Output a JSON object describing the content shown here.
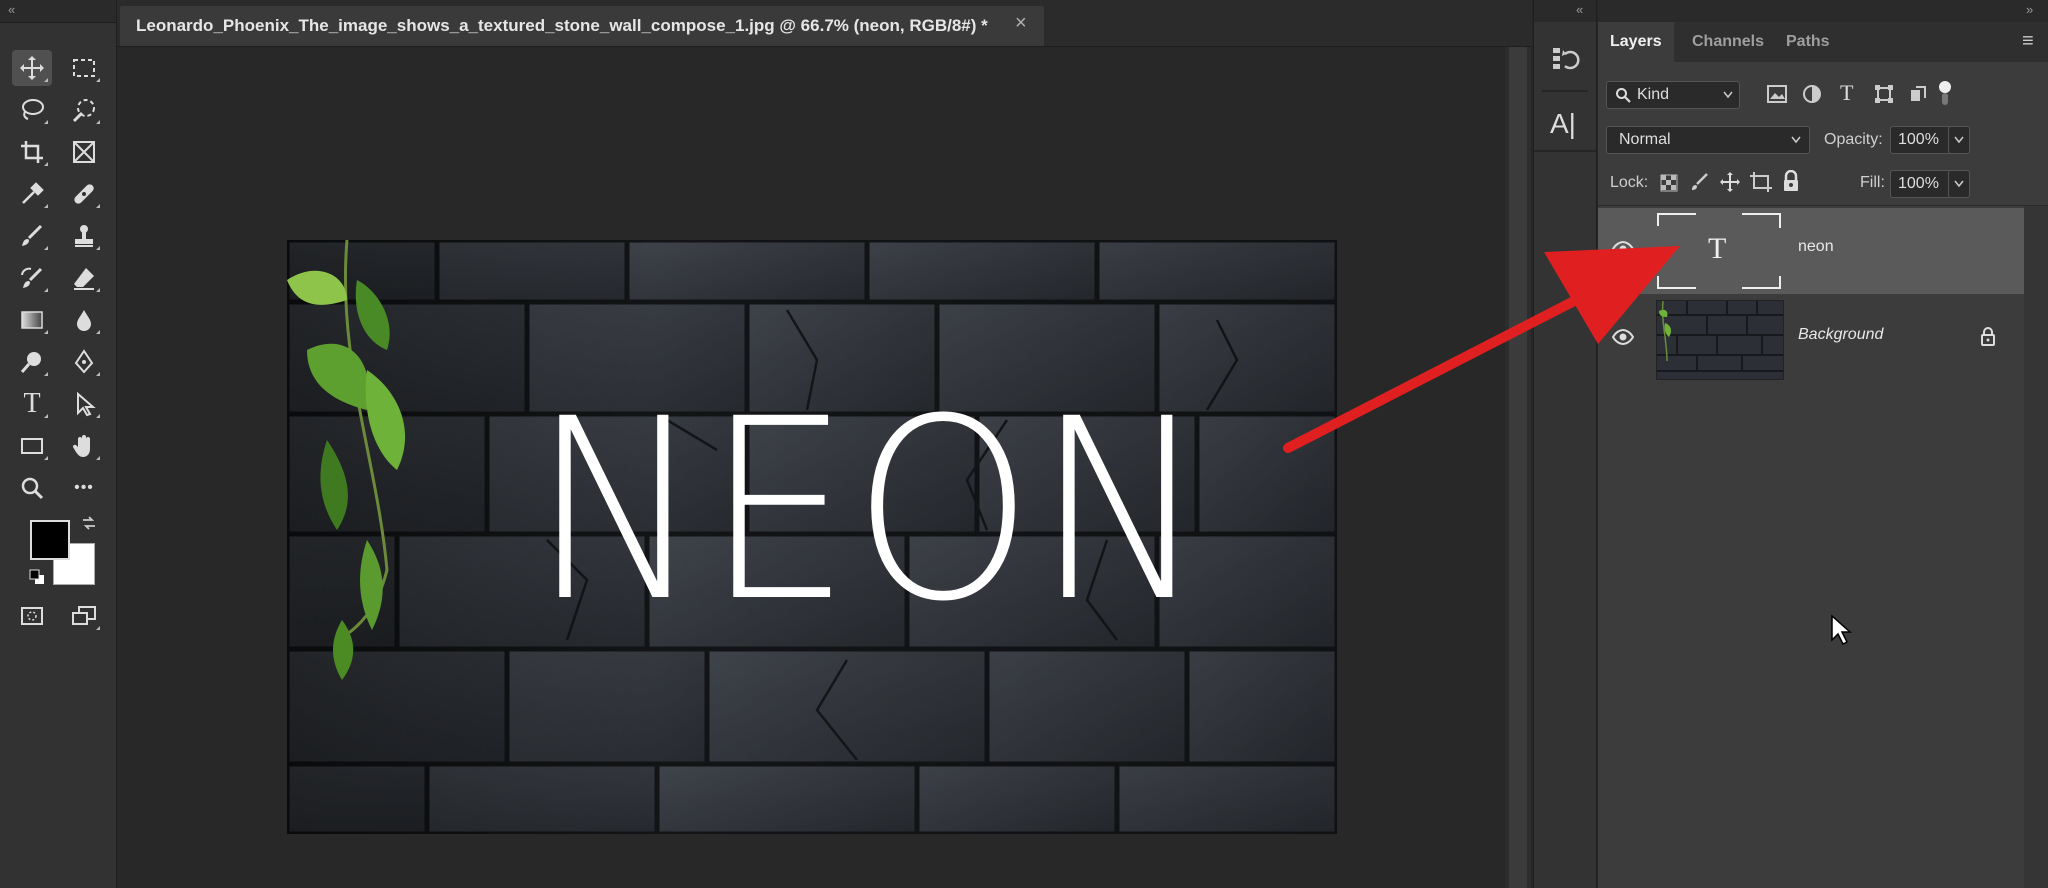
{
  "document": {
    "tab_title": "Leonardo_Phoenix_The_image_shows_a_textured_stone_wall_compose_1.jpg @ 66.7% (neon, RGB/8#) *",
    "close_glyph": "×",
    "canvas_text": "NEON"
  },
  "toolbar": {
    "collapse_glyph": "«",
    "tools": [
      "move-tool",
      "marquee-tool",
      "lasso-tool",
      "quick-select-tool",
      "crop-tool",
      "frame-tool",
      "eyedropper-tool",
      "healing-brush-tool",
      "brush-tool",
      "clone-stamp-tool",
      "history-brush-tool",
      "eraser-tool",
      "gradient-tool",
      "blur-tool",
      "dodge-tool",
      "pen-tool",
      "type-tool",
      "path-selection-tool",
      "rectangle-tool",
      "hand-tool",
      "zoom-tool",
      "more-tools"
    ],
    "type_tool_glyph": "T",
    "more_glyph": "•••",
    "foreground_color": "#000000",
    "background_color": "#ffffff"
  },
  "iconpanel": {
    "collapse_glyph": "«",
    "character_glyph": "A|"
  },
  "panel": {
    "collapse_glyph": "»",
    "menu_glyph": "≡",
    "tabs": [
      "Layers",
      "Channels",
      "Paths"
    ],
    "filter_label": "Kind",
    "blend_mode": "Normal",
    "opacity_label": "Opacity:",
    "opacity_value": "100%",
    "lock_label": "Lock:",
    "fill_label": "Fill:",
    "fill_value": "100%",
    "layers": [
      {
        "name": "neon",
        "thumb_glyph": "T"
      },
      {
        "name": "Background"
      }
    ]
  },
  "colors": {
    "arrow": "#e02020",
    "selected_layer": "#5a5a5a"
  }
}
